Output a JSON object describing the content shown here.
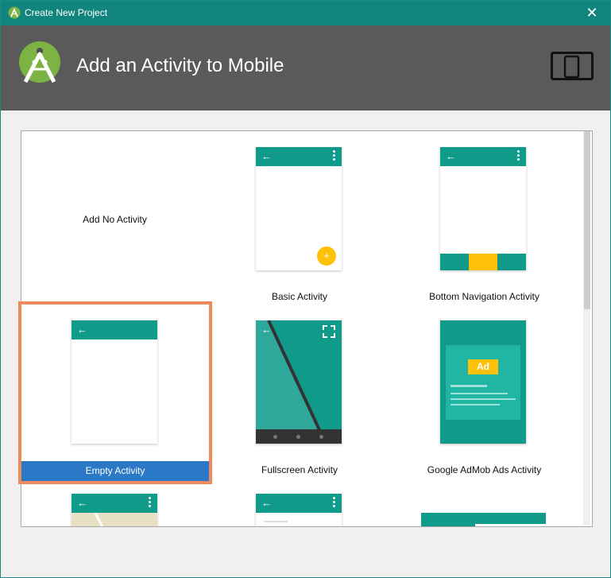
{
  "window": {
    "title": "Create New Project",
    "close_label": "✕"
  },
  "header": {
    "heading": "Add an Activity to Mobile"
  },
  "tiles": [
    {
      "label": "Add No Activity"
    },
    {
      "label": "Basic Activity"
    },
    {
      "label": "Bottom Navigation Activity"
    },
    {
      "label": "Empty Activity",
      "selected": true
    },
    {
      "label": "Fullscreen Activity"
    },
    {
      "label": "Google AdMob Ads Activity",
      "badge": "Ad"
    }
  ],
  "icons": {
    "back": "←",
    "fab": "+"
  },
  "colors": {
    "titlebar": "#11847e",
    "header": "#5a5a5a",
    "teal": "#0f9a8a",
    "accent": "#ffc107",
    "selection_border": "#f0895b",
    "selection_fill": "#2a78c6"
  }
}
